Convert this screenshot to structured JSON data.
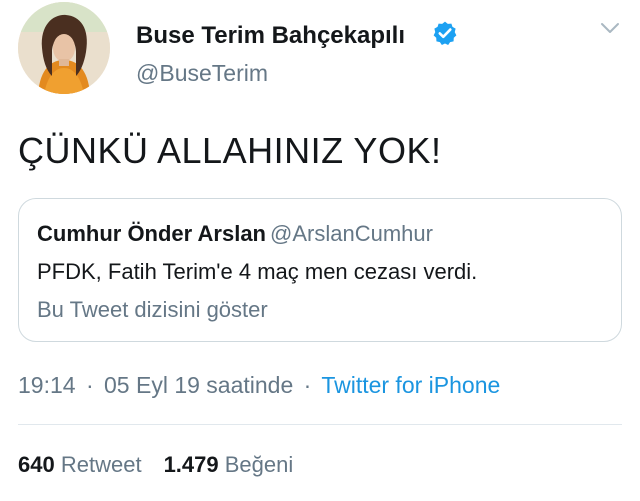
{
  "author": {
    "display_name": "Buse Terim Bahçekapılı",
    "handle": "@BuseTerim",
    "verified": true,
    "avatar_icon": "profile-photo"
  },
  "tweet": {
    "text": "ÇÜNKÜ ALLAHINIZ YOK!"
  },
  "quoted_tweet": {
    "author_name": "Cumhur Önder Arslan",
    "author_handle": "@ArslanCumhur",
    "text": "PFDK, Fatih Terim'e 4 maç men cezası verdi.",
    "thread_link": "Bu Tweet dizisini göster"
  },
  "meta": {
    "time": "19:14",
    "separator": "·",
    "date": "05 Eyl 19 saatinde",
    "source": "Twitter for iPhone"
  },
  "stats": {
    "retweets_count": "640",
    "retweets_label": "Retweet",
    "likes_count": "1.479",
    "likes_label": "Beğeni"
  },
  "colors": {
    "link_blue": "#1b95e0",
    "verified_blue": "#1da1f2",
    "secondary_text": "#657786",
    "border": "#cfd9de"
  }
}
